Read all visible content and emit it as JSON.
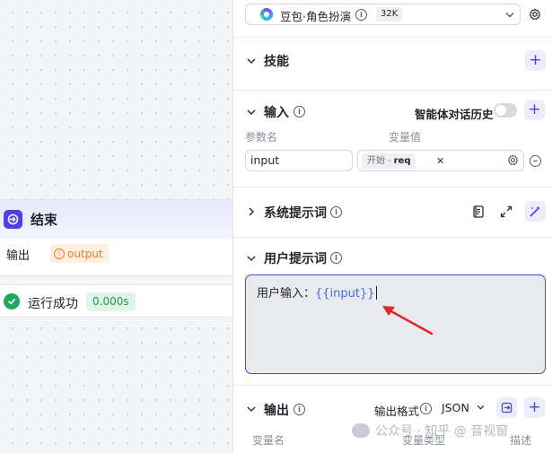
{
  "canvas": {
    "end_node": {
      "title": "结束",
      "output_label": "输出",
      "output_tag": "output",
      "output_tag_icon": "warning-icon"
    },
    "run_status": {
      "text": "运行成功",
      "time": "0.000s",
      "status_color": "#21a85c"
    }
  },
  "panel": {
    "model": {
      "name": "豆包·角色扮演",
      "context_badge": "32K",
      "logo": "doubao-logo-icon"
    },
    "skills": {
      "title": "技能"
    },
    "input": {
      "title": "输入",
      "history_label": "智能体对话历史",
      "history_enabled": false,
      "col_param": "参数名",
      "col_value": "变量值",
      "param_value": "input",
      "var_source": "开始",
      "var_separator": "-",
      "var_name": "req"
    },
    "system_prompt": {
      "title": "系统提示词"
    },
    "user_prompt": {
      "title": "用户提示词",
      "prefix": "用户输入：",
      "variable": "{{input}}"
    },
    "output": {
      "title": "输出",
      "format_label": "输出格式",
      "format_value": "JSON",
      "col_var_name": "变量名",
      "col_var_type": "变量类型",
      "col_desc": "描述"
    }
  },
  "watermark": "公众号 · 知乎 @ 音视窗",
  "colors": {
    "accent": "#4e40e5",
    "warning": "#f07f20",
    "success": "#21a85c",
    "arrow": "#e02a2a"
  }
}
